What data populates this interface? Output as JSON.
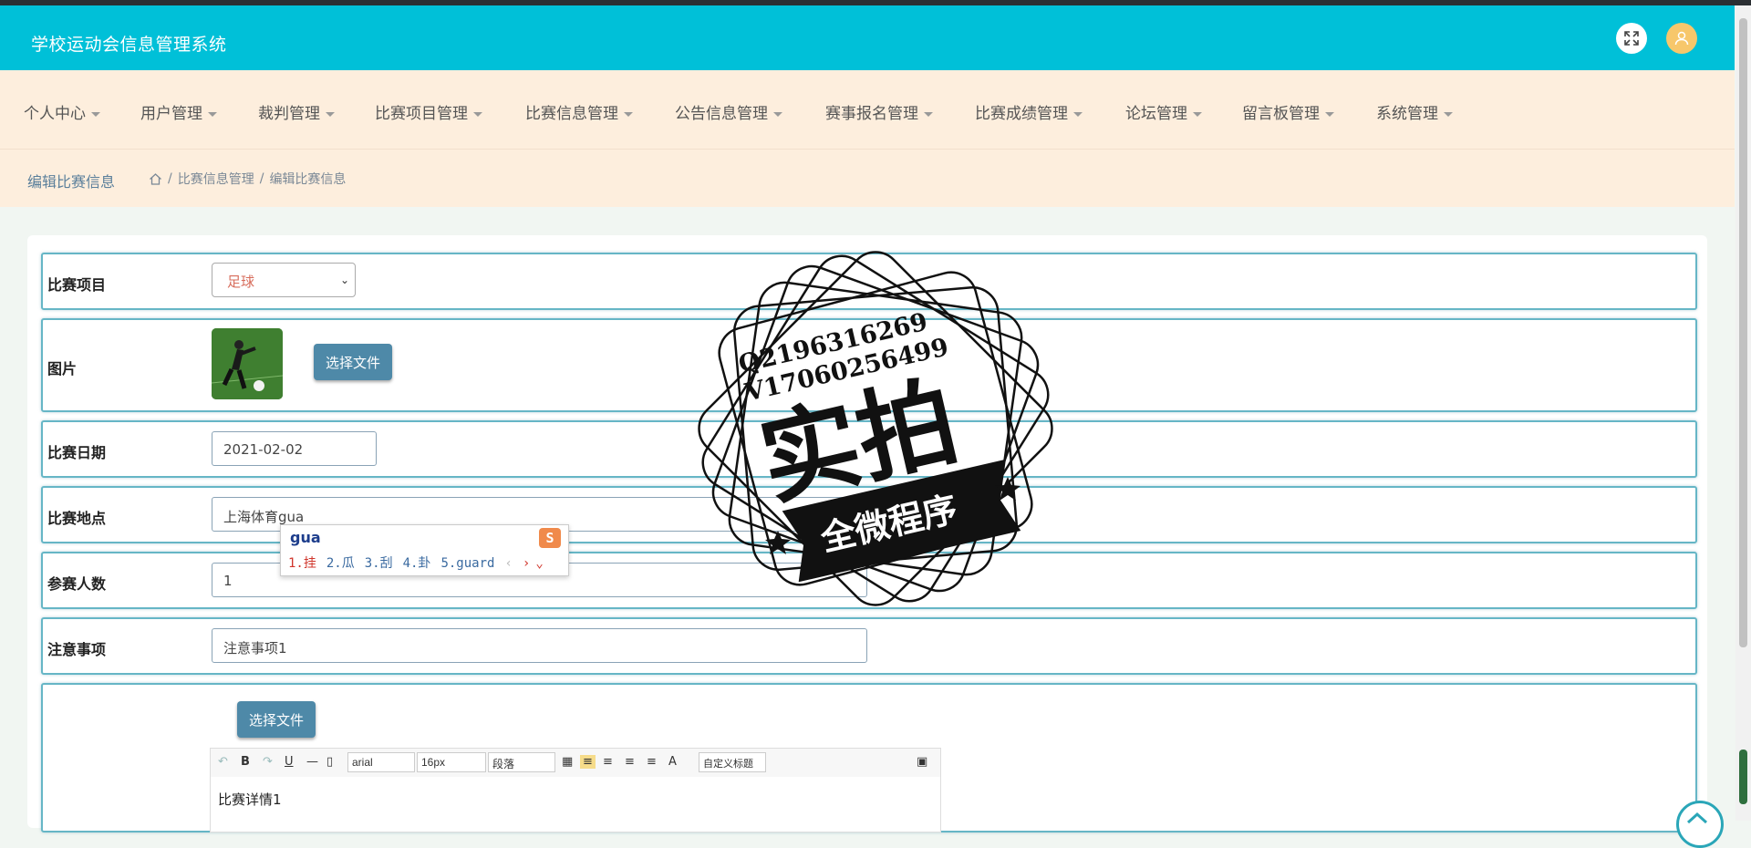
{
  "app": {
    "title": "学校运动会信息管理系统"
  },
  "header": {
    "fullscreen_icon": "expand-icon",
    "user_icon": "user-icon"
  },
  "nav": {
    "items": [
      {
        "label": "个人中心"
      },
      {
        "label": "用户管理"
      },
      {
        "label": "裁判管理"
      },
      {
        "label": "比赛项目管理"
      },
      {
        "label": "比赛信息管理"
      },
      {
        "label": "公告信息管理"
      },
      {
        "label": "赛事报名管理"
      },
      {
        "label": "比赛成绩管理"
      },
      {
        "label": "论坛管理"
      },
      {
        "label": "留言板管理"
      },
      {
        "label": "系统管理"
      }
    ]
  },
  "page": {
    "title": "编辑比赛信息",
    "breadcrumb": {
      "sep": "/",
      "level1": "比赛信息管理",
      "level2": "编辑比赛信息"
    }
  },
  "form": {
    "event": {
      "label": "比赛项目",
      "value": "足球"
    },
    "image": {
      "label": "图片",
      "button": "选择文件"
    },
    "date": {
      "label": "比赛日期",
      "value": "2021-02-02"
    },
    "location": {
      "label": "比赛地点",
      "value": "上海体育gua"
    },
    "participants": {
      "label": "参赛人数",
      "value": "1"
    },
    "notes": {
      "label": "注意事项",
      "value": "注意事项1"
    },
    "details": {
      "button": "选择文件",
      "content": "比赛详情1"
    }
  },
  "ime": {
    "input": "gua",
    "candidates": [
      "1.挂",
      "2.瓜",
      "3.刮",
      "4.卦",
      "5.guard"
    ],
    "logo": "S"
  },
  "editor": {
    "font": "arial",
    "size": "16px",
    "paragraph": "段落",
    "custom_title": "自定义标题",
    "bold": "B",
    "underline": "U",
    "font_color": "A"
  },
  "watermark": {
    "line1": "Q2196316269",
    "line2": "V17060256499",
    "main": "实拍",
    "banner": "全微程序"
  }
}
